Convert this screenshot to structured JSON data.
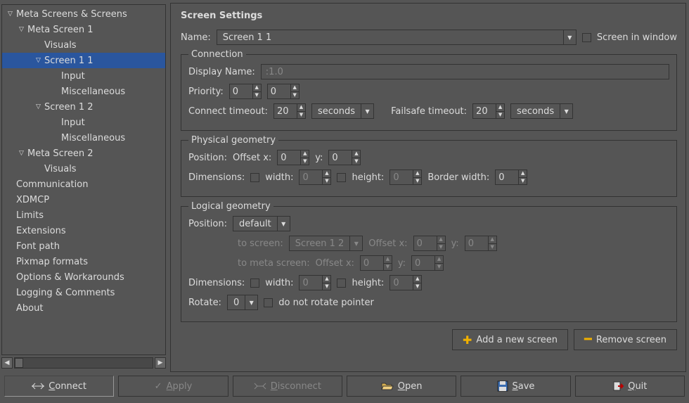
{
  "tree": {
    "root": "Meta Screens & Screens",
    "ms1": "Meta Screen 1",
    "visuals": "Visuals",
    "s11": "Screen 1 1",
    "input": "Input",
    "misc": "Miscellaneous",
    "s12": "Screen 1 2",
    "ms2": "Meta Screen 2",
    "comm": "Communication",
    "xdmcp": "XDMCP",
    "limits": "Limits",
    "ext": "Extensions",
    "font": "Font path",
    "pix": "Pixmap formats",
    "opt": "Options & Workarounds",
    "log": "Logging & Comments",
    "about": "About"
  },
  "title": "Screen Settings",
  "name": {
    "label": "Name:",
    "value": "Screen 1 1",
    "chk_label": "Screen in window"
  },
  "conn": {
    "legend": "Connection",
    "display_label": "Display Name:",
    "display_value": ":1.0",
    "priority_label": "Priority:",
    "p1": "0",
    "p2": "0",
    "ct_label": "Connect timeout:",
    "ct_val": "20",
    "ct_unit": "seconds",
    "ft_label": "Failsafe timeout:",
    "ft_val": "20",
    "ft_unit": "seconds"
  },
  "phys": {
    "legend": "Physical geometry",
    "pos_label": "Position:",
    "ox_label": "Offset x:",
    "ox": "0",
    "y_label": "y:",
    "y": "0",
    "dim_label": "Dimensions:",
    "w_label": "width:",
    "w": "0",
    "h_label": "height:",
    "h": "0",
    "bw_label": "Border width:",
    "bw": "0"
  },
  "log": {
    "legend": "Logical geometry",
    "pos_label": "Position:",
    "pos_val": "default",
    "ts_label": "to screen:",
    "ts_val": "Screen 1 2",
    "ox_label": "Offset x:",
    "ox": "0",
    "y_label": "y:",
    "y": "0",
    "tms_label": "to meta screen:",
    "ox2": "0",
    "y2": "0",
    "dim_label": "Dimensions:",
    "w_label": "width:",
    "w": "0",
    "h_label": "height:",
    "h": "0",
    "rot_label": "Rotate:",
    "rot_val": "0",
    "rot_chk": "do not rotate pointer"
  },
  "actions": {
    "add": "Add a new screen",
    "remove": "Remove screen"
  },
  "bottom": {
    "connect": "onnect",
    "connect_pre": "C",
    "apply": "pply",
    "apply_pre": "A",
    "disconnect": "isconnect",
    "disconnect_pre": "D",
    "open": "pen",
    "open_pre": "O",
    "save": "ave",
    "save_pre": "S",
    "quit": "uit",
    "quit_pre": "Q"
  }
}
